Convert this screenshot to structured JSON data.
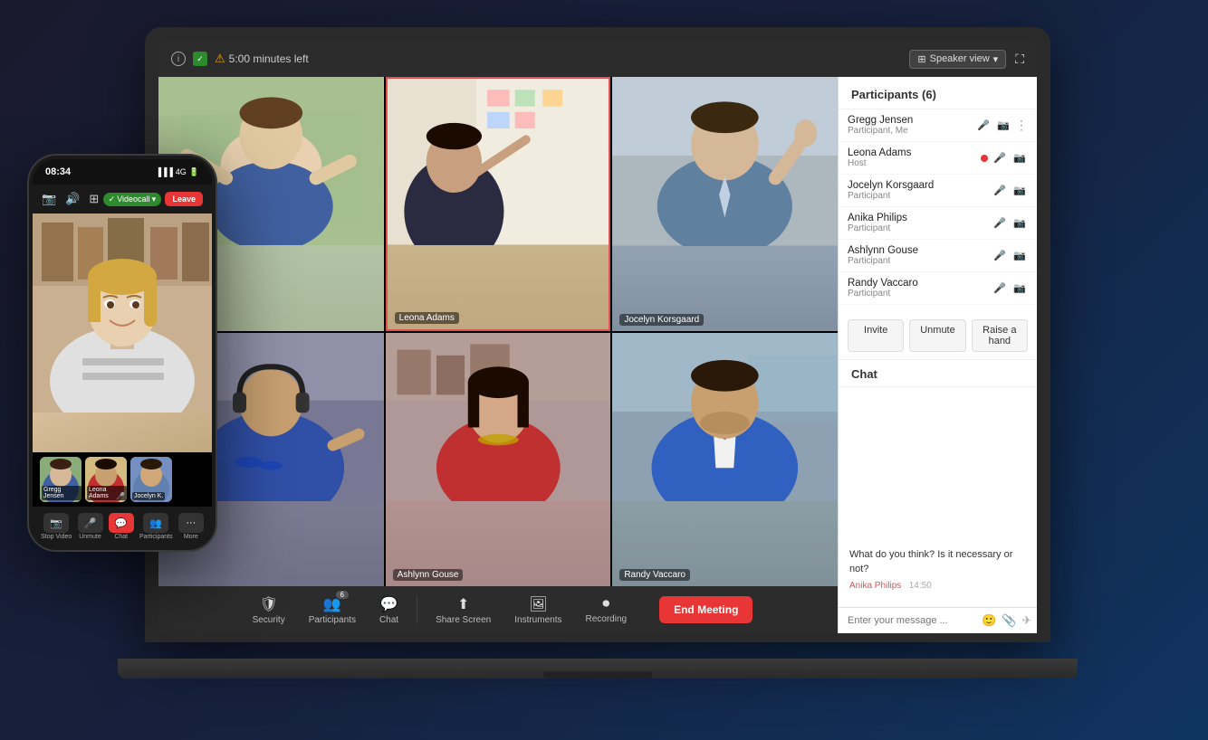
{
  "laptop": {
    "topbar": {
      "timer": "5:00 minutes left",
      "speaker_view_label": "Speaker view",
      "info_label": "i"
    },
    "toolbar": {
      "security_label": "Security",
      "participants_label": "Participants",
      "participants_count": "6",
      "chat_label": "Chat",
      "share_screen_label": "Share Screen",
      "instruments_label": "Instruments",
      "recording_label": "Recording",
      "end_meeting_label": "End Meeting"
    },
    "video_cells": [
      {
        "id": 1,
        "name": "",
        "role": ""
      },
      {
        "id": 2,
        "name": "Leona Adams",
        "role": ""
      },
      {
        "id": 3,
        "name": "Jocelyn Korsgaard",
        "role": ""
      },
      {
        "id": 4,
        "name": "",
        "role": ""
      },
      {
        "id": 5,
        "name": "Ashlynn Gouse",
        "role": ""
      },
      {
        "id": 6,
        "name": "Randy Vaccaro",
        "role": ""
      }
    ]
  },
  "sidebar": {
    "participants_header": "Participants (6)",
    "participants": [
      {
        "name": "Gregg Jensen",
        "role": "Participant, Me",
        "has_more": true
      },
      {
        "name": "Leona Adams",
        "role": "Host",
        "is_host": true
      },
      {
        "name": "Jocelyn Korsgaard",
        "role": "Participant"
      },
      {
        "name": "Anika Philips",
        "role": "Participant"
      },
      {
        "name": "Ashlynn Gouse",
        "role": "Participant"
      },
      {
        "name": "Randy Vaccaro",
        "role": "Participant"
      }
    ],
    "action_buttons": {
      "invite": "Invite",
      "unmute": "Unmute",
      "raise_hand": "Raise a hand"
    },
    "chat_label": "Chat",
    "chat_message": {
      "text": "What do you think? Is it necessary or not?",
      "sender": "Anika Philips",
      "time": "14:50"
    },
    "chat_input_placeholder": "Enter your message ..."
  },
  "phone": {
    "time": "08:34",
    "status": "4G",
    "call_type": "Videocall",
    "leave_label": "Leave",
    "main_person": "User face",
    "thumbnails": [
      {
        "name": "Gregg Jensen"
      },
      {
        "name": "Leona Adams"
      },
      {
        "name": "Jocelyn K."
      }
    ],
    "bottom_buttons": [
      {
        "label": "Stop Video",
        "icon": "📷"
      },
      {
        "label": "Unmute",
        "icon": "🎤"
      },
      {
        "label": "Chat",
        "icon": "💬"
      },
      {
        "label": "Participants",
        "icon": "👥"
      },
      {
        "label": "More",
        "icon": "···"
      }
    ]
  }
}
